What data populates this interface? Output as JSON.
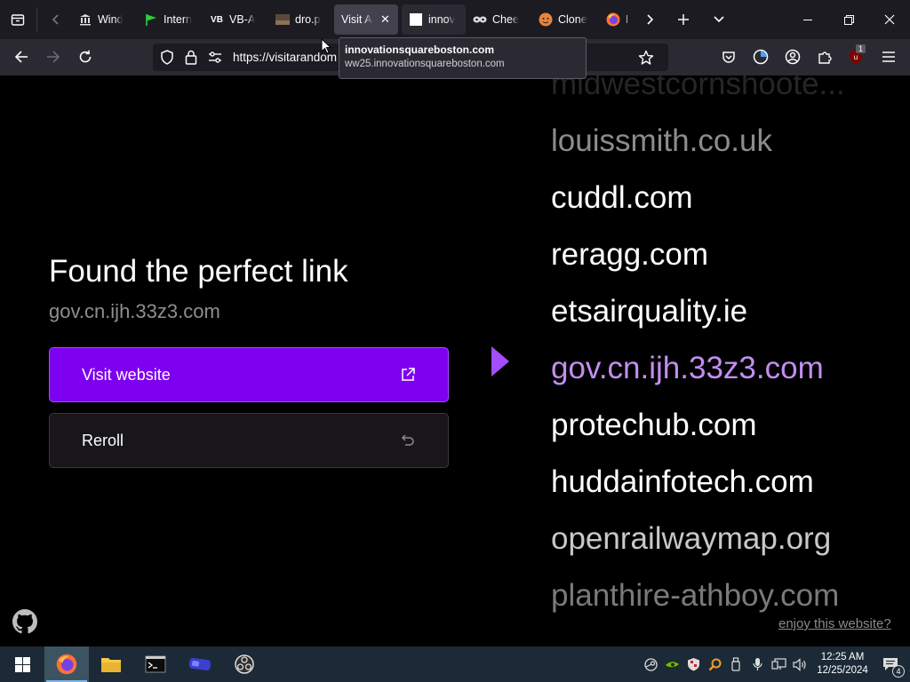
{
  "browser": {
    "tabs": [
      {
        "label": "Wind",
        "icon": "bank-icon"
      },
      {
        "label": "Intern",
        "icon": "green-flag-icon"
      },
      {
        "label": "VB-A",
        "icon": "vb-logo-icon"
      },
      {
        "label": "dro.p",
        "icon": "image-thumbnail-icon"
      },
      {
        "label": "Visit A",
        "icon": "",
        "active": true
      },
      {
        "label": "innov",
        "icon": "blank-page-icon"
      },
      {
        "label": "Chee",
        "icon": "mask-icon"
      },
      {
        "label": "Clone",
        "icon": "orange-face-icon"
      },
      {
        "label": "Ne",
        "icon": "firefox-icon"
      }
    ],
    "url": "https://visitarandom",
    "tooltip": {
      "title": "innovationsquareboston.com",
      "url": "ww25.innovationsquareboston.com"
    },
    "extension_badge": "1"
  },
  "page": {
    "heading": "Found the perfect link",
    "found_link": "gov.cn.ijh.33z3.com",
    "visit_label": "Visit website",
    "reroll_label": "Reroll",
    "enjoy_link": "enjoy this website?",
    "links": [
      {
        "text": "midwestcornshoote...",
        "color": "#262626"
      },
      {
        "text": "louissmith.co.uk",
        "color": "#8c8c8c"
      },
      {
        "text": "cuddl.com",
        "color": "#ffffff"
      },
      {
        "text": "reragg.com",
        "color": "#ffffff"
      },
      {
        "text": "etsairquality.ie",
        "color": "#ffffff"
      },
      {
        "text": "gov.cn.ijh.33z3.com",
        "color": "#c28ef0",
        "selected": true
      },
      {
        "text": "protechub.com",
        "color": "#ffffff"
      },
      {
        "text": "huddainfotech.com",
        "color": "#ffffff"
      },
      {
        "text": "openrailwaymap.org",
        "color": "#c8c8c8"
      },
      {
        "text": "planthire-athboy.com",
        "color": "#7a7a7a"
      }
    ],
    "accent_color": "#7e00f0"
  },
  "taskbar": {
    "time": "12:25 AM",
    "date": "12/25/2024",
    "notification_count": "4"
  }
}
